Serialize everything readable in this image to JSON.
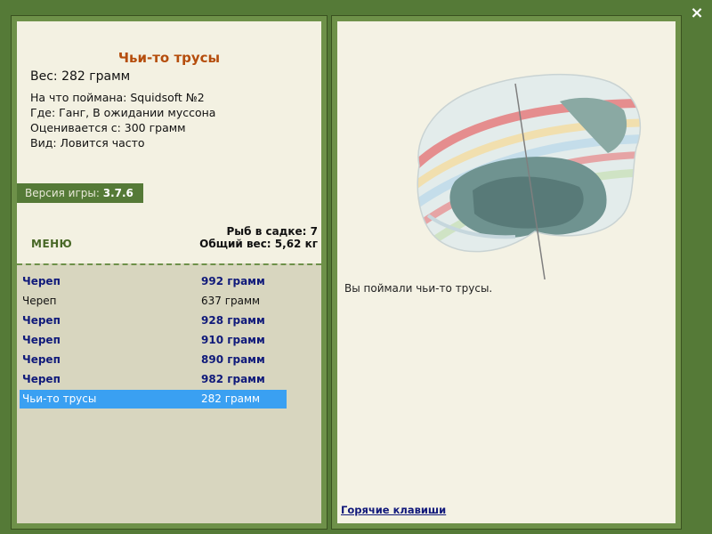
{
  "window": {
    "close_symbol": "×",
    "close_icon": "close-icon"
  },
  "fish": {
    "title": "Чьи-то трусы",
    "weight": "Вес: 282 грамм",
    "details": [
      "На что поймана: Squidsoft №2",
      "Где: Ганг, В ожидании муссона",
      "Оценивается с: 300 грамм",
      "Вид: Ловится часто"
    ]
  },
  "version": {
    "label": "Версия игры: ",
    "value": "3.7.6"
  },
  "menu": {
    "label": "МЕНЮ"
  },
  "keeper": {
    "count_label": "Рыб в садке: 7",
    "total_label": "Общий вес: 5,62 кг"
  },
  "catches": [
    {
      "name": "Череп",
      "weight": "992 грамм",
      "heavy": true,
      "selected": false
    },
    {
      "name": "Череп",
      "weight": "637 грамм",
      "heavy": false,
      "selected": false
    },
    {
      "name": "Череп",
      "weight": "928 грамм",
      "heavy": true,
      "selected": false
    },
    {
      "name": "Череп",
      "weight": "910 грамм",
      "heavy": true,
      "selected": false
    },
    {
      "name": "Череп",
      "weight": "890 грамм",
      "heavy": true,
      "selected": false
    },
    {
      "name": "Череп",
      "weight": "982 грамм",
      "heavy": true,
      "selected": false
    },
    {
      "name": "Чьи-то трусы",
      "weight": "282 грамм",
      "heavy": false,
      "selected": true
    }
  ],
  "colors": {
    "frame": "#557a37",
    "panel": "#f3f1e2",
    "title": "#b54d0c",
    "heavy_catch": "#101a7a",
    "selection": "#3aa0f2"
  },
  "result": {
    "message": "Вы поймали чьи-то трусы.",
    "hotkeys_label": "Горячие клавиши"
  }
}
